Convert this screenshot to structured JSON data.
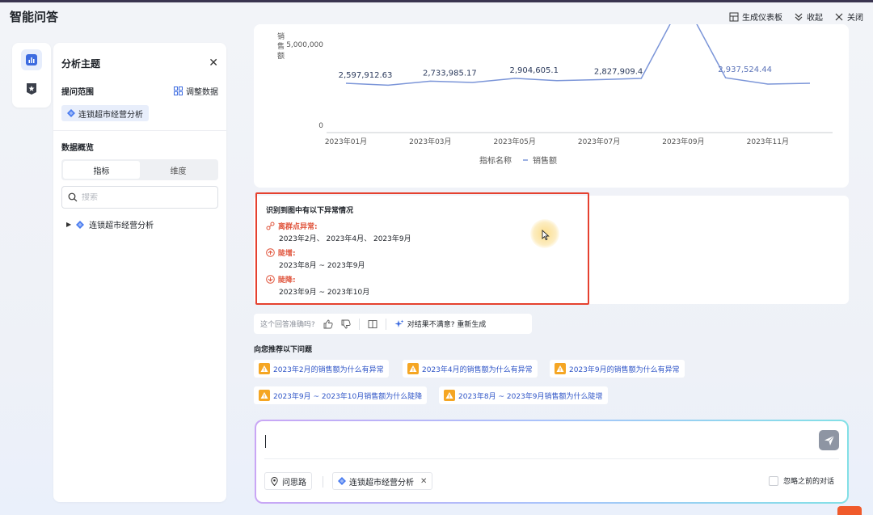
{
  "app": {
    "title": "智能问答"
  },
  "top_actions": [
    {
      "label": "生成仪表板",
      "icon": "dashboard-icon"
    },
    {
      "label": "收起",
      "icon": "collapse-icon"
    },
    {
      "label": "关闭",
      "icon": "close-icon"
    }
  ],
  "sidebar": {
    "title": "分析主题",
    "scope_label": "提问范围",
    "adjust_label": "调整数据",
    "scope_chip": "连锁超市经营分析",
    "overview_label": "数据概览",
    "tabs": [
      "指标",
      "维度"
    ],
    "active_tab": "指标",
    "search_placeholder": "搜索",
    "tree_item": "连锁超市经营分析"
  },
  "chart_data": {
    "type": "line",
    "ylabel": "销售额",
    "yticks": [
      "5,000,000",
      "0"
    ],
    "ylim": [
      0,
      6000000
    ],
    "x": [
      "2023年01月",
      "2023年02月",
      "2023年03月",
      "2023年04月",
      "2023年05月",
      "2023年06月",
      "2023年07月",
      "2023年08月",
      "2023年09月",
      "2023年10月",
      "2023年11月",
      "2023年12月"
    ],
    "xtick_labels": [
      "2023年01月",
      "2023年03月",
      "2023年05月",
      "2023年07月",
      "2023年09月",
      "2023年11月"
    ],
    "series": [
      {
        "name": "销售额",
        "values": [
          2597912.63,
          2480000,
          2733985.17,
          2650000,
          2904605.1,
          2760000,
          2827909.4,
          2900000,
          7800000,
          2937524.44,
          2550000,
          2600000
        ]
      }
    ],
    "data_labels": [
      {
        "index": 0,
        "text": "2,597,912.63"
      },
      {
        "index": 2,
        "text": "2,733,985.17"
      },
      {
        "index": 4,
        "text": "2,904,605.1"
      },
      {
        "index": 6,
        "text": "2,827,909.4"
      },
      {
        "index": 9,
        "text": "2,937,524.44"
      }
    ],
    "legend_title": "指标名称",
    "legend_placement": "bottom",
    "line_color": "#7b95d8",
    "grid": false
  },
  "anomaly": {
    "title": "识别到图中有以下异常情况",
    "items": [
      {
        "type": "离群点异常:",
        "value": "2023年2月、 2023年4月、 2023年9月"
      },
      {
        "type": "陡增:",
        "value": "2023年8月 ~ 2023年9月"
      },
      {
        "type": "陡降:",
        "value": "2023年9月 ~ 2023年10月"
      }
    ]
  },
  "feedback": {
    "question": "这个回答准确吗?",
    "regen": "对结果不满意? 重新生成"
  },
  "recommend": {
    "title": "向您推荐以下问题",
    "questions": [
      "2023年2月的销售额为什么有异常",
      "2023年4月的销售额为什么有异常",
      "2023年9月的销售额为什么有异常",
      "2023年9月 ~ 2023年10月销售额为什么陡降",
      "2023年8月 ~ 2023年9月销售额为什么陡增"
    ]
  },
  "input": {
    "chip_idea": "问思路",
    "chip_scope": "连锁超市经营分析",
    "ignore_label": "忽略之前的对话"
  },
  "colors": {
    "accent": "#2f55c7",
    "warning": "#f5a623",
    "alert": "#e5412f"
  }
}
